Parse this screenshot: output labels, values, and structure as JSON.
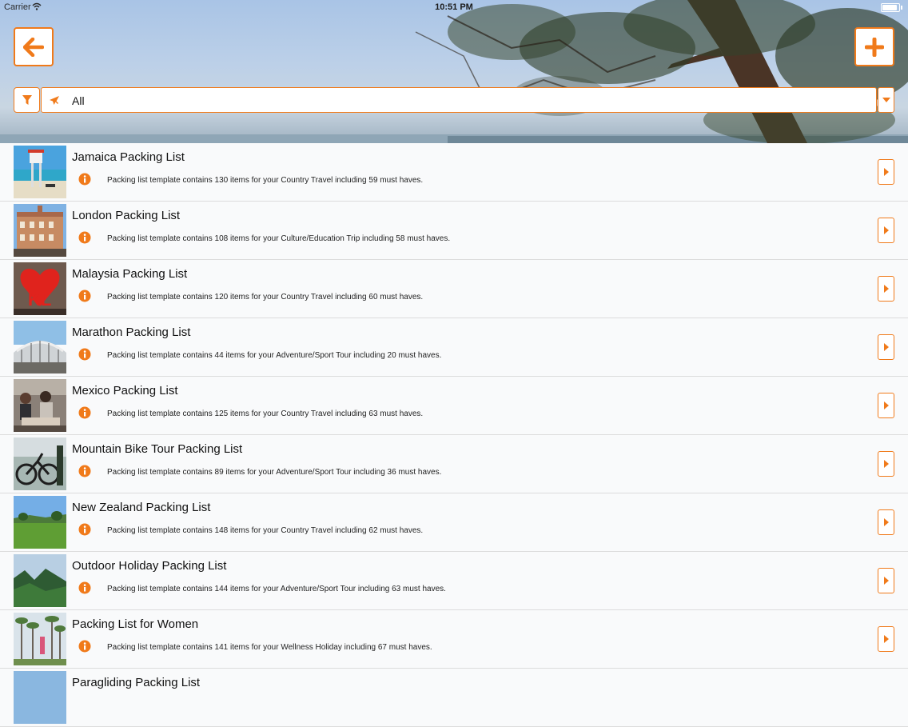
{
  "status_bar": {
    "carrier": "Carrier",
    "time": "10:51 PM"
  },
  "colors": {
    "accent": "#f07a1a",
    "row_background": "#f9fafb"
  },
  "header": {
    "back_icon": "arrow-left-icon",
    "add_icon": "plus-icon"
  },
  "filter": {
    "filter_icon": "funnel-icon",
    "category_icon": "airplane-icon",
    "selected_value": "All",
    "dropdown_icon": "caret-down-icon"
  },
  "packing_lists": [
    {
      "title": "Jamaica Packing List",
      "description": "Packing list template contains 130 items for your Country Travel including 59 must haves.",
      "thumb": "beach lifeguard tower"
    },
    {
      "title": "London Packing List",
      "description": "Packing list template contains 108 items for your Culture/Education Trip including 58 must haves.",
      "thumb": "historic building"
    },
    {
      "title": "Malaysia Packing List",
      "description": "Packing list template contains 120 items for your Country Travel including 60 must haves.",
      "thumb": "red heart sign"
    },
    {
      "title": "Marathon Packing List",
      "description": "Packing list template contains 44 items for your Adventure/Sport Tour including 20 must haves.",
      "thumb": "stadium"
    },
    {
      "title": "Mexico Packing List",
      "description": "Packing list template contains 125 items for your Country Travel including 63 must haves.",
      "thumb": "people at market"
    },
    {
      "title": "Mountain Bike Tour Packing List",
      "description": "Packing list template contains 89 items for your Adventure/Sport Tour including 36 must haves.",
      "thumb": "bikes"
    },
    {
      "title": "New Zealand Packing List",
      "description": "Packing list template contains 148 items for your Country Travel including 62 must haves.",
      "thumb": "green field"
    },
    {
      "title": "Outdoor Holiday Packing List",
      "description": "Packing list template contains 144 items for your Adventure/Sport Tour including 63 must haves.",
      "thumb": "mountains"
    },
    {
      "title": "Packing List for Women",
      "description": "Packing list template contains 141 items for your Wellness Holiday including 67 must haves.",
      "thumb": "palm trees"
    },
    {
      "title": "Paragliding Packing List",
      "description": "",
      "thumb": "sky"
    }
  ]
}
